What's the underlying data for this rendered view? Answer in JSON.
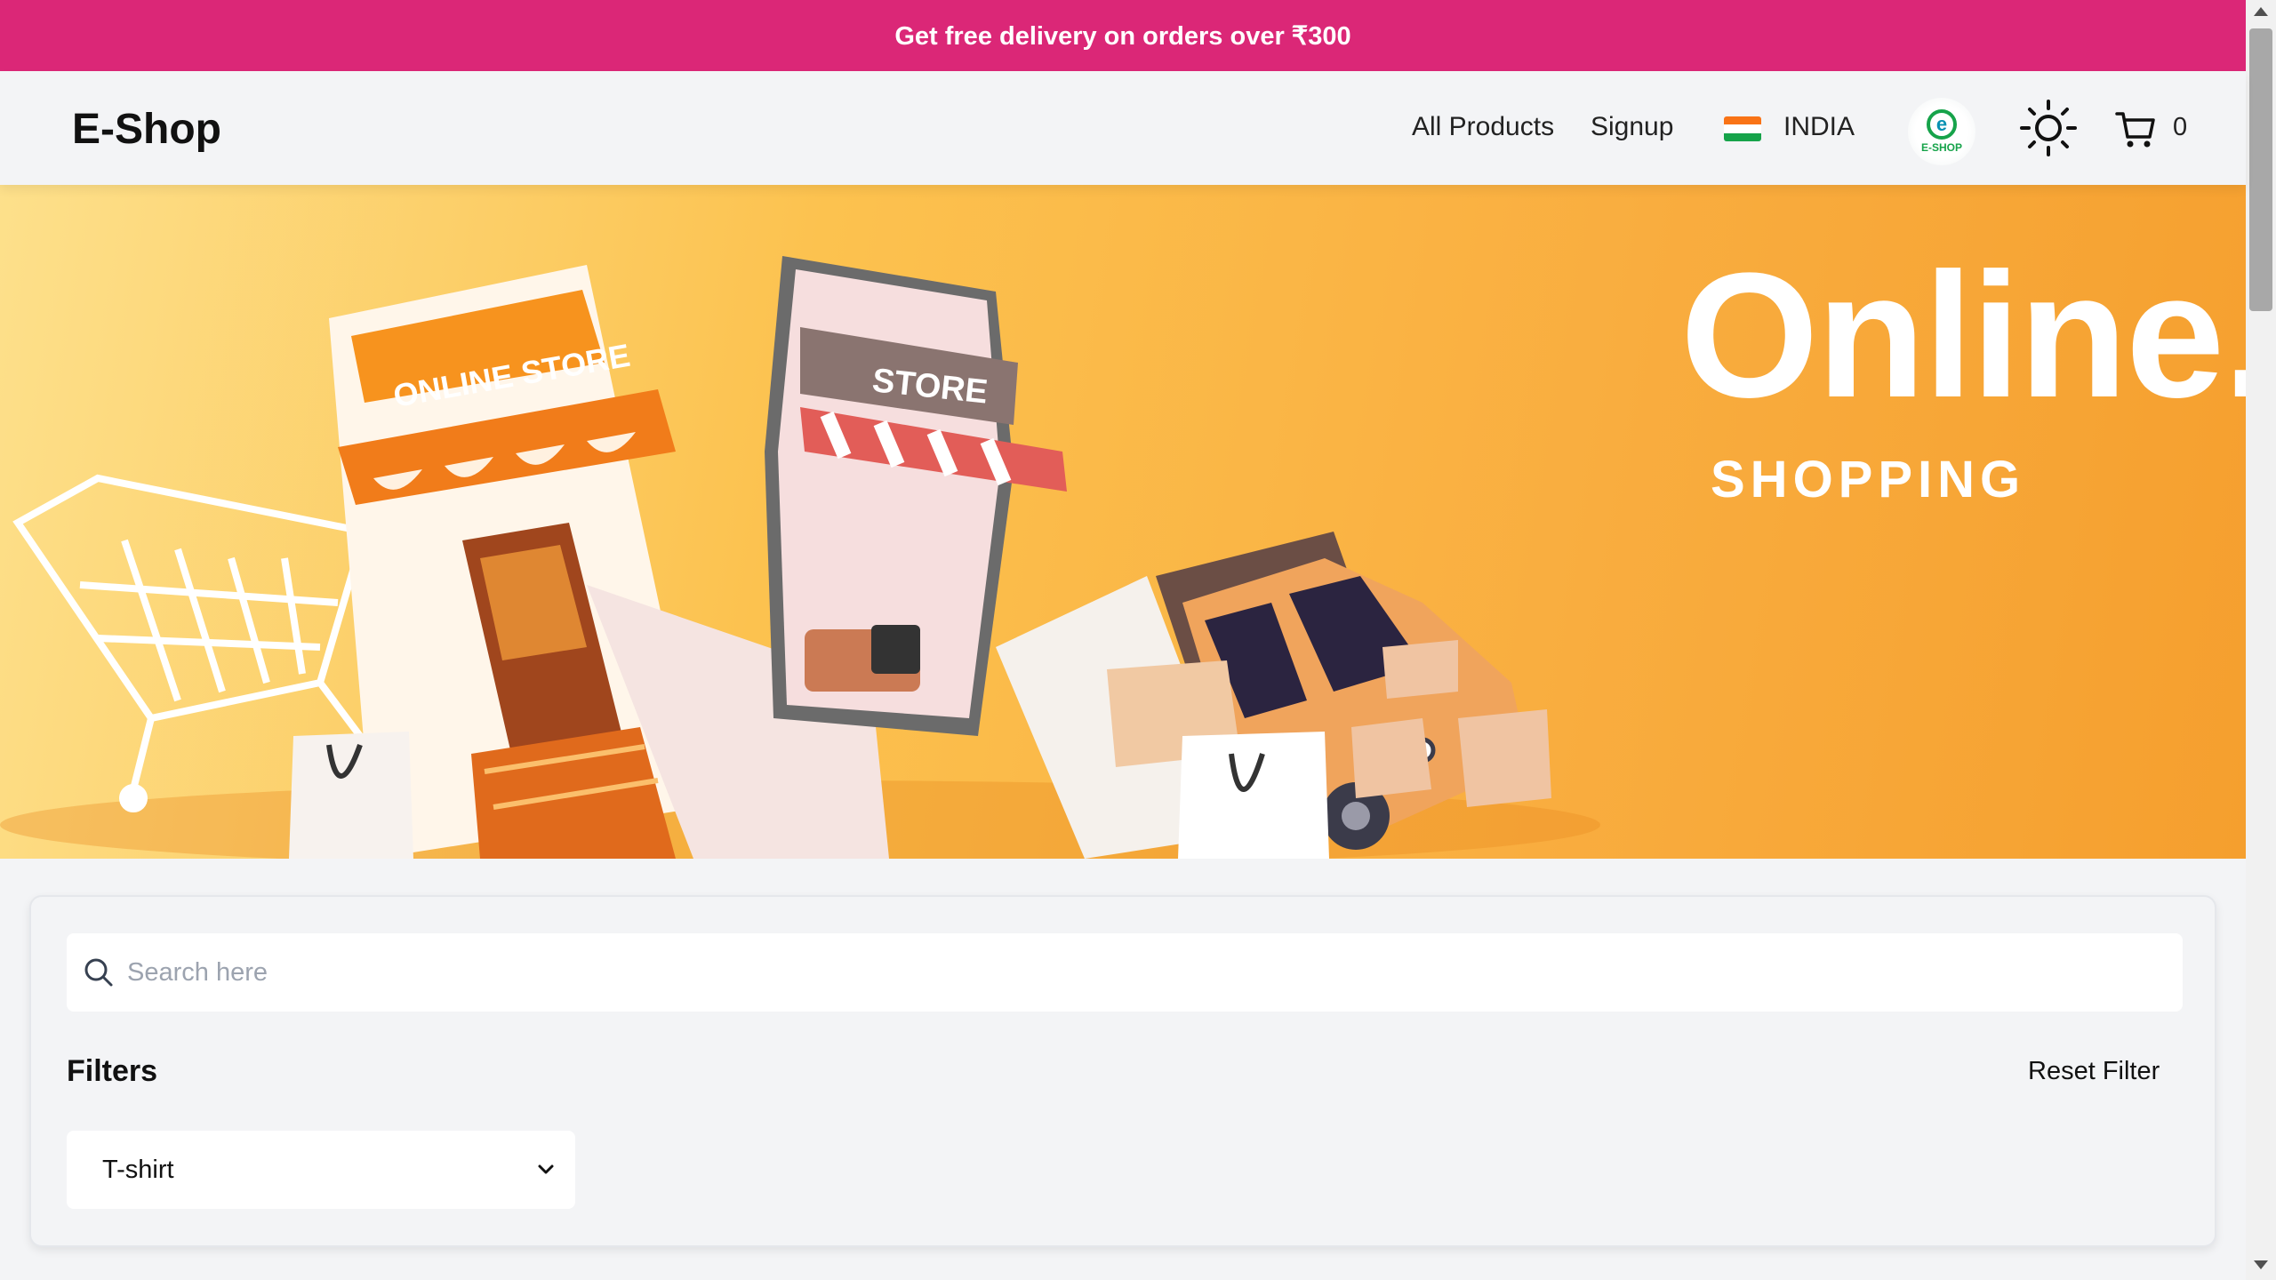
{
  "promo": {
    "text": "Get free delivery on orders over ₹300"
  },
  "header": {
    "logo": "E-Shop",
    "nav": {
      "all_products": "All Products",
      "signup": "Signup"
    },
    "country": "INDIA",
    "brand_badge_text": "E-SHOP",
    "brand_badge_letter": "e",
    "cart_count": "0",
    "icons": [
      "india-flag-icon",
      "eshop-badge-icon",
      "sun-icon",
      "cart-icon"
    ]
  },
  "hero": {
    "title": "Online.",
    "subtitle": "SHOPPING",
    "sign_text": "ONLINE STORE",
    "phone_sign_text": "STORE"
  },
  "filters": {
    "search_placeholder": "Search here",
    "heading": "Filters",
    "reset_label": "Reset Filter",
    "category_selected": "T-shirt"
  },
  "colors": {
    "promo_bg": "#db2777",
    "hero_orange": "#f9ad3f",
    "page_bg": "#f3f4f6"
  }
}
